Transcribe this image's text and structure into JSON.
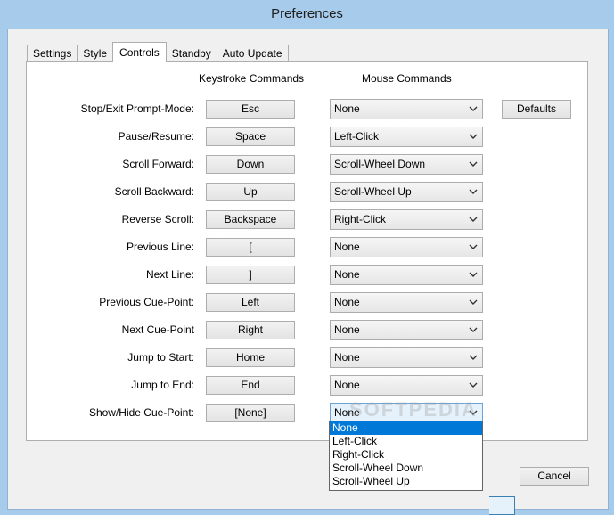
{
  "window": {
    "title": "Preferences"
  },
  "tabs": [
    "Settings",
    "Style",
    "Controls",
    "Standby",
    "Auto Update"
  ],
  "active_tab": "Controls",
  "headers": {
    "keystroke": "Keystroke Commands",
    "mouse": "Mouse Commands"
  },
  "defaults_label": "Defaults",
  "cancel_label": "Cancel",
  "rows": [
    {
      "label": "Stop/Exit Prompt-Mode:",
      "key": "Esc",
      "mouse": "None"
    },
    {
      "label": "Pause/Resume:",
      "key": "Space",
      "mouse": "Left-Click"
    },
    {
      "label": "Scroll Forward:",
      "key": "Down",
      "mouse": "Scroll-Wheel Down"
    },
    {
      "label": "Scroll Backward:",
      "key": "Up",
      "mouse": "Scroll-Wheel Up"
    },
    {
      "label": "Reverse Scroll:",
      "key": "Backspace",
      "mouse": "Right-Click"
    },
    {
      "label": "Previous Line:",
      "key": "[",
      "mouse": "None"
    },
    {
      "label": "Next Line:",
      "key": "]",
      "mouse": "None"
    },
    {
      "label": "Previous Cue-Point:",
      "key": "Left",
      "mouse": "None"
    },
    {
      "label": "Next Cue-Point",
      "key": "Right",
      "mouse": "None"
    },
    {
      "label": "Jump to Start:",
      "key": "Home",
      "mouse": "None"
    },
    {
      "label": "Jump to End:",
      "key": "End",
      "mouse": "None"
    },
    {
      "label": "Show/Hide Cue-Point:",
      "key": "[None]",
      "mouse": "None"
    }
  ],
  "dropdown_options": [
    "None",
    "Left-Click",
    "Right-Click",
    "Scroll-Wheel Down",
    "Scroll-Wheel Up"
  ],
  "dropdown_selected": "None",
  "watermark": "SOFTPEDIA",
  "icons": {
    "select_arrow": "chevron-down-icon"
  }
}
